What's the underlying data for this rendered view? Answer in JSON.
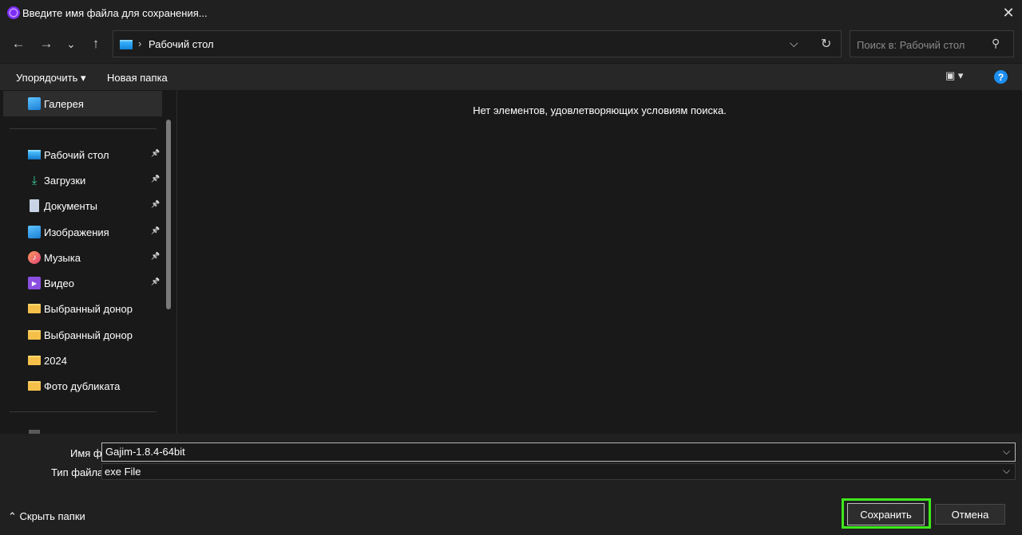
{
  "window": {
    "title": "Введите имя файла для сохранения...",
    "close_glyph": "✕"
  },
  "nav": {
    "back_glyph": "←",
    "forward_glyph": "→",
    "recent_glyph": "⌄",
    "up_glyph": "↑"
  },
  "address": {
    "separator": "›",
    "path": "Рабочий стол",
    "chevron_glyph": "⌵",
    "refresh_glyph": "↻"
  },
  "search": {
    "placeholder": "Поиск в: Рабочий стол",
    "icon_glyph": "⚲"
  },
  "toolbar": {
    "organize_label": "Упорядочить ▾",
    "new_folder_label": "Новая папка",
    "view_glyph": "▣ ▾",
    "help_glyph": "?"
  },
  "sidebar": {
    "gallery": {
      "label": "Галерея",
      "icon": "gallery-icon"
    },
    "items": [
      {
        "label": "Рабочий стол",
        "icon": "desktop-icon",
        "pinned": true
      },
      {
        "label": "Загрузки",
        "icon": "downloads-icon",
        "pinned": true
      },
      {
        "label": "Документы",
        "icon": "documents-icon",
        "pinned": true
      },
      {
        "label": "Изображения",
        "icon": "pictures-icon",
        "pinned": true
      },
      {
        "label": "Музыка",
        "icon": "music-icon",
        "pinned": true
      },
      {
        "label": "Видео",
        "icon": "video-icon",
        "pinned": true
      },
      {
        "label": "Выбранный донор",
        "icon": "folder-icon",
        "pinned": false
      },
      {
        "label": "Выбранный донор",
        "icon": "folder-icon",
        "pinned": false
      },
      {
        "label": "2024",
        "icon": "folder-icon",
        "pinned": false
      },
      {
        "label": "Фото дубликата",
        "icon": "folder-icon",
        "pinned": false
      }
    ],
    "pin_glyph": "📌"
  },
  "main": {
    "empty_message": "Нет элементов, удовлетворяющих условиям поиска."
  },
  "form": {
    "filename_label": "Имя файла:",
    "filename_value": "Gajim-1.8.4-64bit",
    "filetype_label": "Тип файла:",
    "filetype_value": "exe File",
    "chevron_glyph": "⌵"
  },
  "footer": {
    "hide_folders_label": "Скрыть папки",
    "hide_folders_glyph": "⌃",
    "save_label": "Сохранить",
    "cancel_label": "Отмена"
  },
  "colors": {
    "accent_highlight": "#3ee81c",
    "help_blue": "#1c8ef0",
    "app_icon": "#7b2ff7"
  }
}
